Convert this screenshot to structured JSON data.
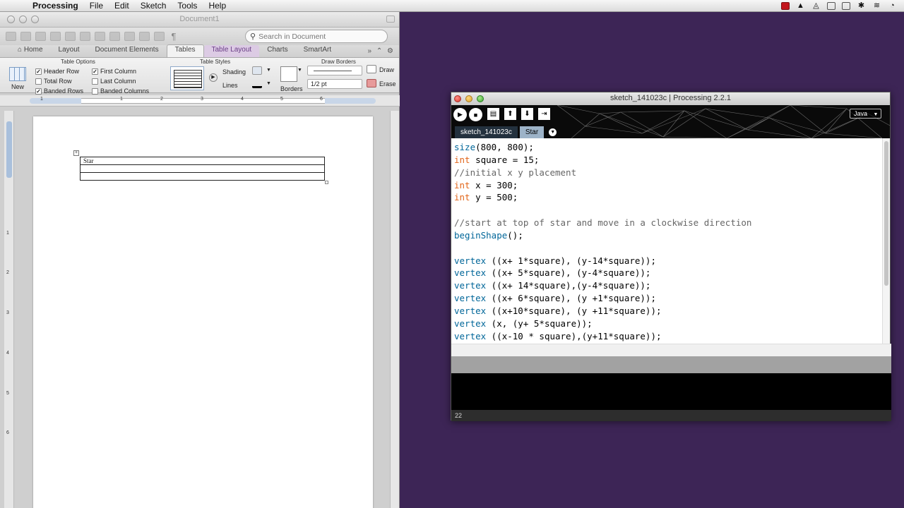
{
  "menubar": {
    "app": "Processing",
    "items": [
      "File",
      "Edit",
      "Sketch",
      "Tools",
      "Help"
    ]
  },
  "word": {
    "doc_title": "Document1",
    "search_placeholder": "Search in Document",
    "ribbon_tabs": [
      "Home",
      "Layout",
      "Document Elements",
      "Tables",
      "Table Layout",
      "Charts",
      "SmartArt"
    ],
    "groups": {
      "table_options": "Table Options",
      "table_styles": "Table Styles",
      "draw_borders": "Draw Borders"
    },
    "new_label": "New",
    "options": {
      "header_row": "Header Row",
      "total_row": "Total Row",
      "banded_rows": "Banded Rows",
      "first_column": "First Column",
      "last_column": "Last Column",
      "banded_columns": "Banded Columns"
    },
    "shading": "Shading",
    "lines": "Lines",
    "borders": "Borders",
    "line_weight": "1/2 pt",
    "draw": "Draw",
    "erase": "Erase",
    "table_cell": "Star",
    "ruler_numbers": [
      "1",
      "1",
      "2",
      "3",
      "4",
      "5",
      "6"
    ],
    "vruler_numbers": [
      "1",
      "2",
      "3",
      "4",
      "5",
      "6"
    ]
  },
  "processing": {
    "title": "sketch_141023c | Processing 2.2.1",
    "mode": "Java",
    "tabs": [
      "sketch_141023c",
      "Star"
    ],
    "line_number": "22",
    "code": [
      [
        [
          "fn",
          "size"
        ],
        [
          "tx",
          "(800, 800);"
        ]
      ],
      [
        [
          "kw",
          "int"
        ],
        [
          "tx",
          " square = 15;"
        ]
      ],
      [
        [
          "cm",
          "//initial x y placement"
        ]
      ],
      [
        [
          "kw",
          "int"
        ],
        [
          "tx",
          " x = 300;"
        ]
      ],
      [
        [
          "kw",
          "int"
        ],
        [
          "tx",
          " y = 500;"
        ]
      ],
      [],
      [
        [
          "cm",
          "//start at top of star and move in a clockwise direction"
        ]
      ],
      [
        [
          "fn",
          "beginShape"
        ],
        [
          "tx",
          "();"
        ]
      ],
      [],
      [
        [
          "fn",
          "vertex"
        ],
        [
          "tx",
          " ((x+ 1*square), (y-14*square));"
        ]
      ],
      [
        [
          "fn",
          "vertex"
        ],
        [
          "tx",
          " ((x+ 5*square), (y-4*square));"
        ]
      ],
      [
        [
          "fn",
          "vertex"
        ],
        [
          "tx",
          " ((x+ 14*square),(y-4*square));"
        ]
      ],
      [
        [
          "fn",
          "vertex"
        ],
        [
          "tx",
          " ((x+ 6*square), (y +1*square));"
        ]
      ],
      [
        [
          "fn",
          "vertex"
        ],
        [
          "tx",
          " ((x+10*square), (y +11*square));"
        ]
      ],
      [
        [
          "fn",
          "vertex"
        ],
        [
          "tx",
          " (x, (y+ 5*square));"
        ]
      ],
      [
        [
          "fn",
          "vertex"
        ],
        [
          "tx",
          " ((x-10 * square),(y+11*square));"
        ]
      ]
    ]
  }
}
